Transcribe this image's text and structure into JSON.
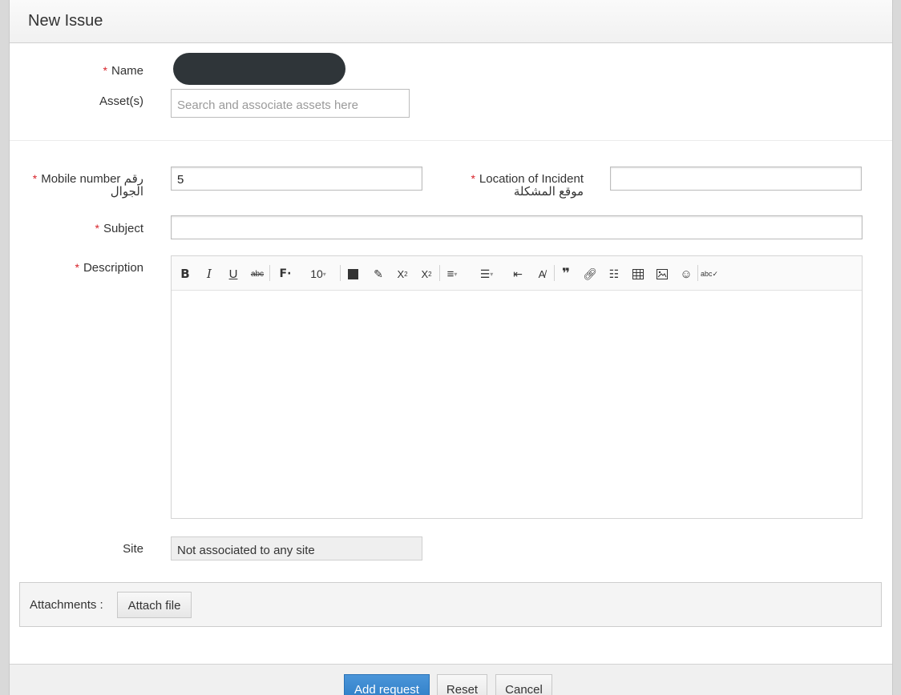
{
  "header": {
    "title": "New Issue"
  },
  "form": {
    "name_label": "Name",
    "assets_label": "Asset(s)",
    "assets_placeholder": "Search and associate assets here",
    "mobile_label": "Mobile number رقم",
    "mobile_label_ar": "الجوال",
    "mobile_value": "5",
    "location_label": "Location of Incident",
    "location_label_ar": "موقع المشكلة",
    "location_value": "",
    "subject_label": "Subject",
    "subject_value": "",
    "description_label": "Description",
    "site_label": "Site",
    "site_value": "Not associated to any site"
  },
  "editor": {
    "font_size": "10",
    "toolbar_icons": [
      "bold-icon",
      "italic-icon",
      "underline-icon",
      "strikethrough-icon",
      "font-family-icon",
      "font-size-select",
      "text-color-icon",
      "highlight-icon",
      "subscript-icon",
      "superscript-icon",
      "align-icon",
      "bullet-list-icon",
      "outdent-icon",
      "clear-format-icon",
      "blockquote-icon",
      "link-icon",
      "line-spacing-icon",
      "table-icon",
      "image-icon",
      "emoji-icon",
      "spellcheck-icon"
    ]
  },
  "attachments": {
    "label": "Attachments :",
    "attach_button": "Attach file"
  },
  "footer": {
    "add_button": "Add request",
    "reset_button": "Reset",
    "cancel_button": "Cancel"
  },
  "colors": {
    "required": "#d8232a",
    "primary": "#3a88cf",
    "avatar": "#2f3539"
  }
}
